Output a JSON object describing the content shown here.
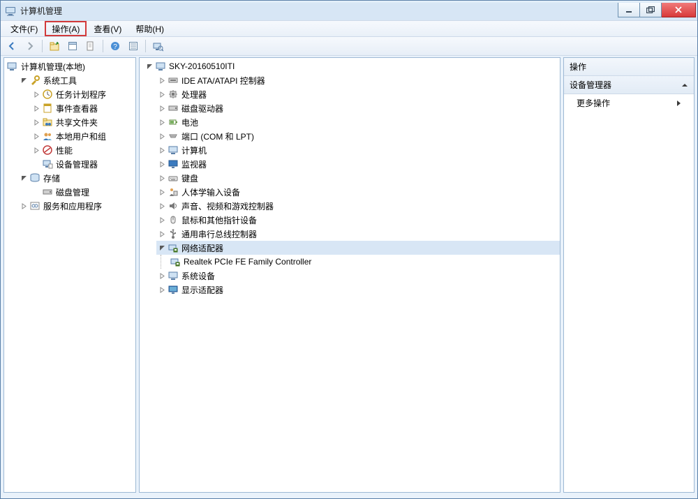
{
  "window": {
    "title": "计算机管理"
  },
  "menu": {
    "file": "文件(F)",
    "action": "操作(A)",
    "view": "查看(V)",
    "help": "帮助(H)"
  },
  "left_tree": {
    "root": "计算机管理(本地)",
    "system_tools": "系统工具",
    "task_scheduler": "任务计划程序",
    "event_viewer": "事件查看器",
    "shared_folders": "共享文件夹",
    "local_users": "本地用户和组",
    "performance": "性能",
    "device_manager": "设备管理器",
    "storage": "存储",
    "disk_management": "磁盘管理",
    "services_apps": "服务和应用程序"
  },
  "device_tree": {
    "root": "SKY-20160510ITI",
    "ide": "IDE ATA/ATAPI 控制器",
    "cpu": "处理器",
    "disk": "磁盘驱动器",
    "battery": "电池",
    "ports": "端口 (COM 和 LPT)",
    "computer": "计算机",
    "monitor": "监视器",
    "keyboard": "键盘",
    "hid": "人体学输入设备",
    "sound": "声音、视频和游戏控制器",
    "mouse": "鼠标和其他指针设备",
    "usb": "通用串行总线控制器",
    "network": "网络适配器",
    "network_child": "Realtek PCIe FE Family Controller",
    "system_devices": "系统设备",
    "display": "显示适配器"
  },
  "right": {
    "header": "操作",
    "subheader": "设备管理器",
    "more_actions": "更多操作"
  }
}
